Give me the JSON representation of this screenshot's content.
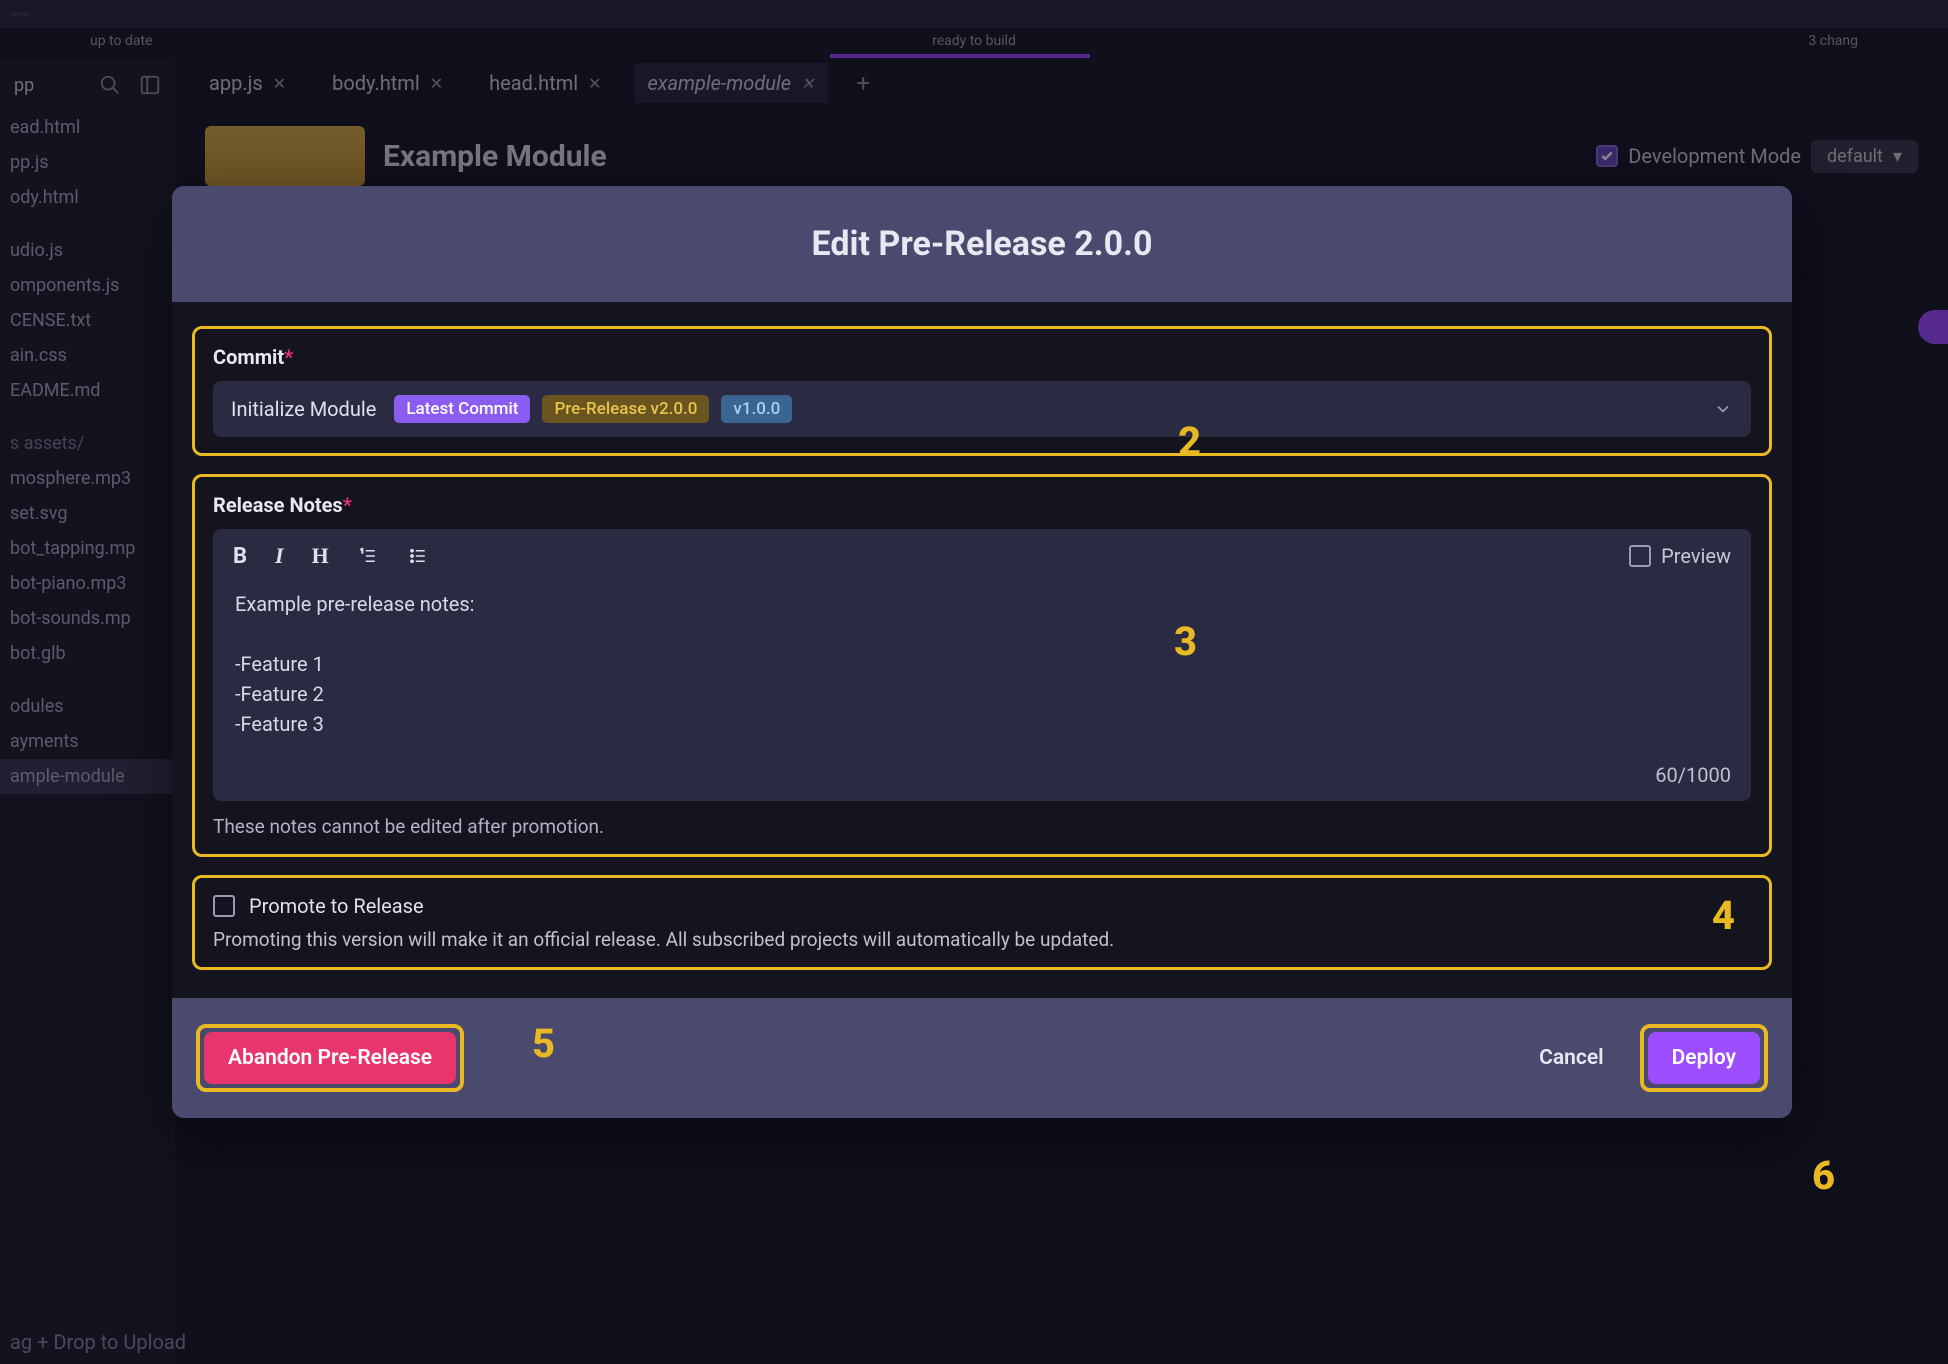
{
  "topbar": {
    "status_left": "up to date",
    "status_center": "ready to build",
    "status_right": "3 chang"
  },
  "sidebar": {
    "files_root": [
      "ead.html",
      "pp.js",
      "ody.html"
    ],
    "files_mid": [
      "udio.js",
      "omponents.js",
      "CENSE.txt",
      "ain.css",
      "EADME.md"
    ],
    "assets_label": "s  assets/",
    "files_assets": [
      "mosphere.mp3",
      "set.svg",
      "bot_tapping.mp",
      "bot-piano.mp3",
      "bot-sounds.mp",
      "bot.glb"
    ],
    "bottom": [
      "odules",
      "ayments",
      "ample-module"
    ],
    "upload_hint": "ag + Drop to Upload",
    "trunc_app": "pp"
  },
  "tabs": [
    {
      "label": "app.js",
      "close": true,
      "active": false
    },
    {
      "label": "body.html",
      "close": true,
      "active": false
    },
    {
      "label": "head.html",
      "close": true,
      "active": false
    },
    {
      "label": "example-module",
      "close": true,
      "active": true
    }
  ],
  "header": {
    "title": "Example Module",
    "dev_mode": "Development Mode",
    "default": "default"
  },
  "modal": {
    "title": "Edit Pre-Release 2.0.0",
    "commit": {
      "label": "Commit",
      "message": "Initialize Module",
      "badges": {
        "latest": "Latest Commit",
        "prerelease": "Pre-Release v2.0.0",
        "v1": "v1.0.0"
      }
    },
    "notes": {
      "label": "Release Notes",
      "preview": "Preview",
      "content_l1": "Example pre-release notes:",
      "content_l2": "-Feature 1",
      "content_l3": "-Feature 2",
      "content_l4": "-Feature 3",
      "count": "60/1000",
      "help": "These notes cannot be edited after promotion."
    },
    "promote": {
      "label": "Promote to Release",
      "desc": "Promoting this version will make it an official release. All subscribed projects will automatically be updated."
    },
    "buttons": {
      "abandon": "Abandon Pre-Release",
      "cancel": "Cancel",
      "deploy": "Deploy"
    }
  },
  "callouts": {
    "n2": "2",
    "n3": "3",
    "n4": "4",
    "n5": "5",
    "n6": "6"
  }
}
